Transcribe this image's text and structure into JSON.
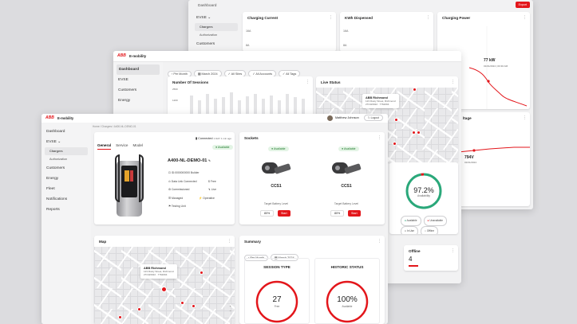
{
  "back": {
    "breadcrumb": "Dashboard",
    "export_label": "Export",
    "sidebar": {
      "evse": "EVSE",
      "chargers": "Chargers",
      "authorization": "Authorization",
      "customers": "Customers"
    },
    "cards": [
      {
        "title": "Charging Current",
        "axis": [
          "16A",
          "8A"
        ]
      },
      {
        "title": "KWh Dispensed",
        "axis": [
          "16A",
          "8A"
        ]
      },
      {
        "title": "Charging Power",
        "value": "77 kW",
        "note": "01/01/2024 | 00:30 AM"
      }
    ],
    "logout_label": "Logout",
    "voltage": {
      "title": "ltage",
      "value": "794V",
      "note": "01/01/2024"
    }
  },
  "middle": {
    "brand": "E-mobility",
    "sidebar": [
      "Dashboard",
      "EVSE",
      "Customers",
      "Energy"
    ],
    "filters": [
      "Per Month",
      "March 2024",
      "All Sites",
      "All Accounts",
      "All Tags"
    ],
    "sessions": {
      "title": "Number Of Sessions",
      "axis": [
        "2500",
        "1200"
      ]
    },
    "live": {
      "title": "Live Status",
      "popup_title": "ABB Richmond",
      "popup_lines": [
        "123 Rusty Street, Richmond",
        "27/10/2022 · 7762094"
      ]
    },
    "availability": {
      "percent": "97.2%",
      "label": "Availability",
      "legend": [
        "Available",
        "Unavailable",
        "In Use",
        "Offline"
      ]
    },
    "offline": {
      "title": "Offline",
      "value": "4"
    }
  },
  "front": {
    "brand": "E-mobility",
    "user_name": "Matthew Johnson",
    "logout_label": "Logout",
    "breadcrumb": "Home  /  Chargers  /  A400-NL-DEMO-01",
    "sidebar": {
      "items": [
        "Dashboard",
        "EVSE",
        "Customers",
        "Energy",
        "Fleet",
        "Notifications",
        "Reports"
      ],
      "sub": [
        "Chargers",
        "Authorization"
      ]
    },
    "tabs": [
      "General",
      "Service",
      "Model"
    ],
    "connected": "Connected",
    "connected_time": "1 DAY 1 min  ago",
    "charger": {
      "badge": "Available",
      "name": "A400-NL-DEMO-01",
      "serial": "ID:0000000000 Builder",
      "features": [
        "Data Link Connected",
        "Free",
        "Commissioned",
        "Live",
        "Managed",
        "Operative",
        "Testing Unit"
      ]
    },
    "sockets": {
      "title": "Sockets",
      "items": [
        {
          "badge": "Available",
          "name": "CCS1",
          "level_label": "Target Battery Level",
          "level": "80%",
          "start": "Start"
        },
        {
          "badge": "Available",
          "name": "CCS1",
          "level_label": "Target Battery Level",
          "level": "80%",
          "start": "Start"
        }
      ]
    },
    "map": {
      "title": "Map",
      "popup_title": "ABB Richmond",
      "popup_lines": [
        "123 Rusty Street, Richmond",
        "27/10/2022 · 7762094"
      ]
    },
    "summary": {
      "title": "Summary",
      "filters": [
        "Per Month",
        "March 2024"
      ],
      "session_type": {
        "title": "SESSION TYPE",
        "value": "27",
        "label": "Free"
      },
      "historic": {
        "title": "HISTORIC STATUS",
        "value": "100%",
        "label": "Available"
      }
    }
  }
}
